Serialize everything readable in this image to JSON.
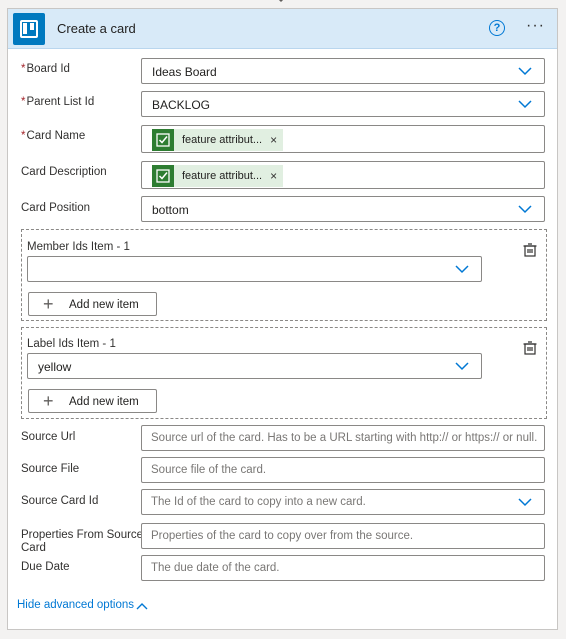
{
  "header": {
    "title": "Create a card",
    "brand_color": "#0079bf",
    "accent_color": "#0078d4",
    "help_symbol": "?",
    "more_symbol": "···"
  },
  "fields": {
    "board_id": {
      "label": "Board Id",
      "required": true,
      "value": "Ideas Board"
    },
    "parent_list_id": {
      "label": "Parent List Id",
      "required": true,
      "value": "BACKLOG"
    },
    "card_name": {
      "label": "Card Name",
      "required": true,
      "token": "feature attribut...",
      "token_close": "×"
    },
    "card_description": {
      "label": "Card Description",
      "required": false,
      "token": "feature attribut...",
      "token_close": "×"
    },
    "card_position": {
      "label": "Card Position",
      "required": false,
      "value": "bottom"
    },
    "member_ids": {
      "label": "Member Ids Item - 1",
      "value": "",
      "add_label": "Add new item"
    },
    "label_ids": {
      "label": "Label Ids Item - 1",
      "value": "yellow",
      "add_label": "Add new item"
    },
    "source_url": {
      "label": "Source Url",
      "placeholder": "Source url of the card. Has to be a URL starting with http:// or https:// or null."
    },
    "source_file": {
      "label": "Source File",
      "placeholder": "Source file of the card."
    },
    "source_card_id": {
      "label": "Source Card Id",
      "placeholder": "The Id of the card to copy into a new card."
    },
    "properties_from_source": {
      "label_line1": "Properties From Source",
      "label_line2": "Card",
      "placeholder": "Properties of the card to copy over from the source."
    },
    "due_date": {
      "label": "Due Date",
      "placeholder": "The due date of the card."
    }
  },
  "footer": {
    "advanced_label": "Hide advanced options"
  },
  "required_marker": "*",
  "icons": {
    "logo": "trello-logo",
    "help": "help-circle-icon",
    "more": "more-horizontal-icon",
    "dropdown": "chevron-down-icon",
    "token": "approval-check-icon",
    "delete_item": "delete-item-icon",
    "add": "plus-icon",
    "collapse": "chevron-up-icon"
  }
}
